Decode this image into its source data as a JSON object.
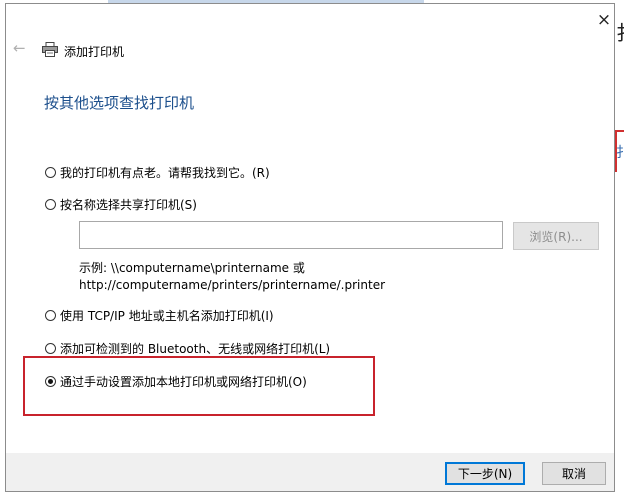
{
  "dialog": {
    "wizard_title": "添加打印机",
    "heading": "按其他选项查找打印机",
    "close_glyph": "×",
    "back_glyph": "←",
    "options": [
      {
        "label": "我的打印机有点老。请帮我找到它。(R)",
        "checked": false
      },
      {
        "label": "按名称选择共享打印机(S)",
        "checked": false
      },
      {
        "label": "使用 TCP/IP 地址或主机名添加打印机(I)",
        "checked": false
      },
      {
        "label": "添加可检测到的 Bluetooth、无线或网络打印机(L)",
        "checked": false
      },
      {
        "label": "通过手动设置添加本地打印机或网络打印机(O)",
        "checked": true
      }
    ],
    "share_input": {
      "value": "",
      "placeholder": ""
    },
    "browse_label": "浏览(R)...",
    "example_line1": "示例: \\\\computername\\printername 或",
    "example_line2": "http://computername/printers/printername/.printer",
    "next_label": "下一步(N)",
    "cancel_label": "取消"
  },
  "background": {
    "glyph_top": "扌",
    "glyph_mid": "扌"
  },
  "colors": {
    "heading": "#1c4f8c",
    "highlight": "#c8232c",
    "primary_border": "#0078d7"
  },
  "icons": {
    "printer": "printer-icon",
    "back": "back-arrow-icon",
    "close": "close-icon"
  }
}
